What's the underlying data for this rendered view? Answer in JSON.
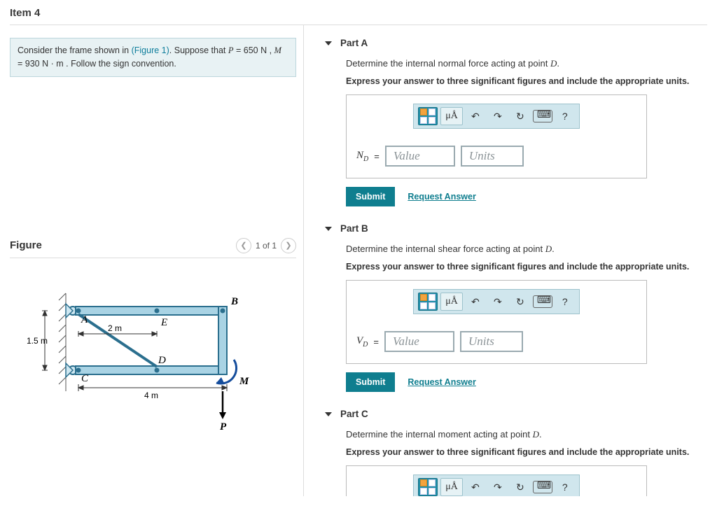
{
  "item_title": "Item 4",
  "brief": {
    "pre": "Consider the frame shown in ",
    "fig_link": "(Figure 1)",
    "mid1": ". Suppose that ",
    "p_var": "P",
    "p_eq": " = 650  N , ",
    "m_var": "M",
    "m_eq": " = 930  N · m . Follow the sign convention."
  },
  "figure": {
    "heading": "Figure",
    "nav_label": "1 of 1",
    "labels": {
      "A": "A",
      "B": "B",
      "C": "C",
      "D": "D",
      "E": "E",
      "M": "M",
      "P": "P",
      "d2m": "2 m",
      "d4m": "4 m",
      "d15": "1.5 m"
    }
  },
  "toolbar": {
    "mu": "μÅ",
    "undo": "↶",
    "redo": "↷",
    "reset": "↻",
    "help": "?"
  },
  "common": {
    "value_ph": "Value",
    "units_ph": "Units",
    "submit": "Submit",
    "request": "Request Answer",
    "eq": "="
  },
  "parts": {
    "A": {
      "title": "Part A",
      "question_pre": "Determine the internal normal force acting at point ",
      "question_pt": "D",
      "question_post": ".",
      "instr": "Express your answer to three significant figures and include the appropriate units.",
      "var_html": "N",
      "var_sub": "D"
    },
    "B": {
      "title": "Part B",
      "question_pre": "Determine the internal shear force acting at point ",
      "question_pt": "D",
      "question_post": ".",
      "instr": "Express your answer to three significant figures and include the appropriate units.",
      "var_html": "V",
      "var_sub": "D"
    },
    "C": {
      "title": "Part C",
      "question_pre": "Determine the internal moment acting at point ",
      "question_pt": "D",
      "question_post": ".",
      "instr": "Express your answer to three significant figures and include the appropriate units."
    }
  }
}
